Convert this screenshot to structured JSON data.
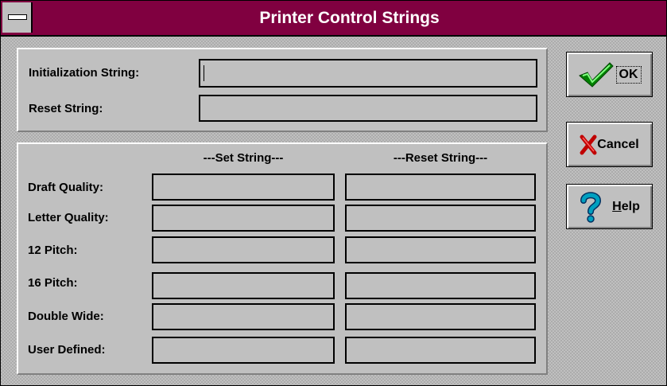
{
  "window": {
    "title": "Printer Control Strings"
  },
  "top_group": {
    "init_label": "Initialization String:",
    "init_value": "",
    "reset_label": "Reset String:",
    "reset_value": ""
  },
  "codes_group": {
    "set_header": "---Set String---",
    "reset_header": "---Reset String---",
    "rows": [
      {
        "label": "Draft Quality:",
        "set": "",
        "reset": ""
      },
      {
        "label": "Letter Quality:",
        "set": "",
        "reset": ""
      },
      {
        "label": "12 Pitch:",
        "set": "",
        "reset": ""
      },
      {
        "label": "16 Pitch:",
        "set": "",
        "reset": ""
      },
      {
        "label": "Double Wide:",
        "set": "",
        "reset": ""
      },
      {
        "label": "User Defined:",
        "set": "",
        "reset": ""
      }
    ]
  },
  "buttons": {
    "ok": {
      "label": "OK",
      "icon": "checkmark-icon"
    },
    "cancel": {
      "label": "Cancel",
      "icon": "red-x-icon"
    },
    "help": {
      "label_prefix": "",
      "label_underline": "H",
      "label_rest": "elp",
      "icon": "question-mark-icon"
    }
  },
  "colors": {
    "titlebar": "#800040",
    "check_green": "#008000",
    "cancel_red": "#c00000",
    "help_blue": "#00a0c0"
  }
}
